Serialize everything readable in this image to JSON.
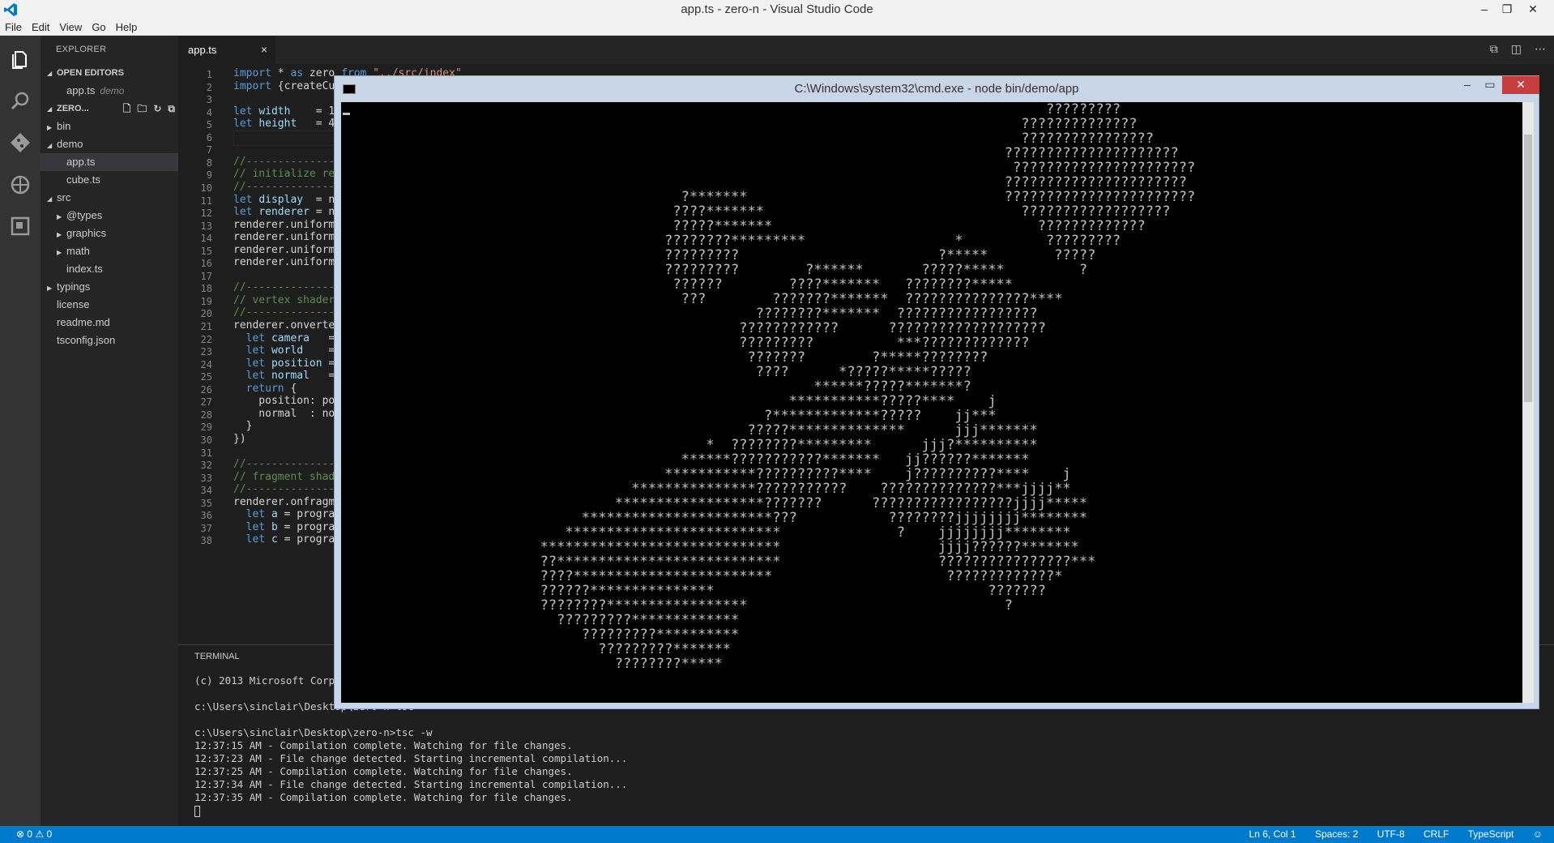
{
  "window": {
    "title": "app.ts - zero-n - Visual Studio Code"
  },
  "menu": [
    "File",
    "Edit",
    "View",
    "Go",
    "Help"
  ],
  "activity": [
    "explorer-icon",
    "search-icon",
    "git-icon",
    "debug-icon",
    "extensions-icon"
  ],
  "sidebar": {
    "header": "EXPLORER",
    "open_editors": {
      "label": "OPEN EDITORS",
      "item": "app.ts",
      "item_detail": "demo"
    },
    "project": {
      "label": "ZERO..."
    },
    "tree": [
      {
        "label": "bin",
        "kind": "folder",
        "state": "collapsed",
        "level": 1
      },
      {
        "label": "demo",
        "kind": "folder",
        "state": "expanded",
        "level": 1
      },
      {
        "label": "app.ts",
        "kind": "file",
        "level": 2,
        "selected": true
      },
      {
        "label": "cube.ts",
        "kind": "file",
        "level": 2
      },
      {
        "label": "src",
        "kind": "folder",
        "state": "expanded",
        "level": 1
      },
      {
        "label": "@types",
        "kind": "folder",
        "state": "collapsed",
        "level": 2
      },
      {
        "label": "graphics",
        "kind": "folder",
        "state": "collapsed",
        "level": 2
      },
      {
        "label": "math",
        "kind": "folder",
        "state": "collapsed",
        "level": 2
      },
      {
        "label": "index.ts",
        "kind": "file",
        "level": 2
      },
      {
        "label": "typings",
        "kind": "folder",
        "state": "collapsed",
        "level": 1
      },
      {
        "label": "license",
        "kind": "file",
        "level": 1
      },
      {
        "label": "readme.md",
        "kind": "file",
        "level": 1
      },
      {
        "label": "tsconfig.json",
        "kind": "file",
        "level": 1
      }
    ]
  },
  "tab": {
    "label": "app.ts"
  },
  "editor": {
    "lines": [
      "import * as zero from \"../src/index\"",
      "import {createCu",
      "",
      "let width    = 1",
      "let height   = 4",
      "",
      "",
      "//--------------",
      "// initialize re",
      "//--------------",
      "let display  = n",
      "let renderer = n",
      "renderer.uniform",
      "renderer.uniform",
      "renderer.uniform",
      "renderer.uniform",
      "",
      "//--------------",
      "// vertex shader",
      "//--------------",
      "renderer.onverte",
      "  let camera   =",
      "  let world    =",
      "  let position =",
      "  let normal   =",
      "  return {",
      "    position: po",
      "    normal  : no",
      "  }",
      "})",
      "",
      "//--------------",
      "// fragment shad",
      "//--------------",
      "renderer.onfragm",
      "  let a = progra",
      "  let b = progra",
      "  let c = progra"
    ]
  },
  "panel": {
    "title": "TERMINAL",
    "lines": [
      "(c) 2013 Microsoft Corp",
      "",
      "c:\\Users\\sinclair\\Desktop\\zero-n>tsc",
      "",
      "c:\\Users\\sinclair\\Desktop\\zero-n>tsc -w",
      "12:37:15 AM - Compilation complete. Watching for file changes.",
      "12:37:23 AM - File change detected. Starting incremental compilation...",
      "12:37:25 AM - Compilation complete. Watching for file changes.",
      "12:37:34 AM - File change detected. Starting incremental compilation...",
      "12:37:35 AM - Compilation complete. Watching for file changes."
    ]
  },
  "cmd": {
    "title": "C:\\Windows\\system32\\cmd.exe - node  bin/demo/app",
    "ascii": [
      "                                                             ?????????",
      "                                                          ??????????????",
      "                                                          ????????????????",
      "                                                        ?????????????????????",
      "                                                         ??????????????????????",
      "                                                        ??????????????????????",
      "                 ?*******                               ???????????????????????",
      "                ????*******                               ??????????????????",
      "                ?????*******                                ?????????????",
      "               ????????*********                  *          ?????????",
      "               ?????????                        ?*****        ?????",
      "               ?????????        ?******       ?????*****         ?",
      "                ??????        ????*******   ????????*****",
      "                 ???        ???????*******  ???????????????****",
      "                          ????????*******  ?????????????????",
      "                        ????????????      ???????????????????",
      "                        ?????????          ***?????????????",
      "                         ???????        ?*****????????",
      "                          ????      *?????*****?????",
      "                                 ******?????*******?",
      "                              ***********?????****    j",
      "                           ?*************?????    jj***",
      "                         ?????**************      jjj*******",
      "                    *  ????????*********      jjj?**********",
      "                 ******???????????*******   jj??????*******",
      "               ***********??????????****    j??????????****    j",
      "           ***************???????????    ??????????????***jjjj**",
      "         ******************???????      ?????????????????jjjj*****",
      "     ***********************???           ????????jjjjjjjj********",
      "   **************************              ?    jjjjjjjj********",
      "*****************************                   jjjj??????*******",
      "??***************************                   ????????????????***",
      "????************************                     ?????????????*",
      "??????***************                                 ???????",
      "????????*****************                               ?",
      "  ?????????*************",
      "     ?????????**********",
      "       ?????????*******",
      "         ????????*****"
    ]
  },
  "status": {
    "errors": "0",
    "warnings": "0",
    "position": "Ln 6, Col 1",
    "spaces": "Spaces: 2",
    "encoding": "UTF-8",
    "eol": "CRLF",
    "language": "TypeScript"
  }
}
